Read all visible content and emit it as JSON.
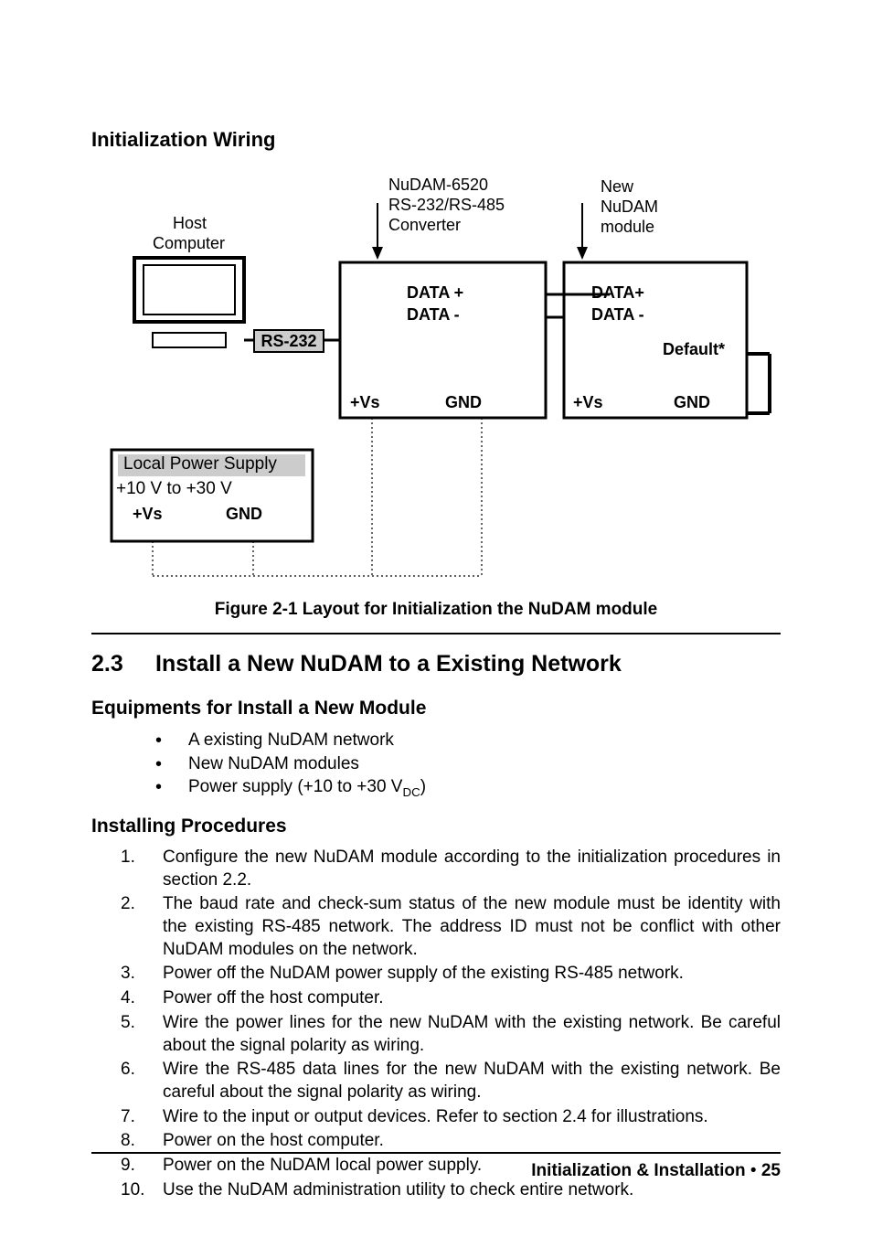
{
  "heading_init_wiring": "Initialization Wiring",
  "diagram": {
    "host_computer_l1": "Host",
    "host_computer_l2": "Computer",
    "converter_l1": "NuDAM-6520",
    "converter_l2": "RS-232/RS-485",
    "converter_l3": "Converter",
    "new_module_l1": "New",
    "new_module_l2": "NuDAM",
    "new_module_l3": "module",
    "rs232_label": "RS-232",
    "data_plus": "DATA +",
    "data_minus": "DATA -",
    "data_plus_b": "DATA+",
    "data_minus_b": "DATA -",
    "default_label": "Default*",
    "vs": "+Vs",
    "gnd": "GND",
    "power_title": "Local Power Supply",
    "power_range": "+10 V to +30 V",
    "caption": "Figure 2-1  Layout for Initialization the NuDAM module"
  },
  "section": {
    "num": "2.3",
    "title": "Install a New NuDAM to a Existing Network"
  },
  "equip_heading": "Equipments for Install a New Module",
  "equip_items": {
    "i1": "A existing NuDAM network",
    "i2": "New NuDAM modules",
    "i3_pre": "Power supply (+10 to +30 V",
    "i3_sub": "DC",
    "i3_post": ")"
  },
  "proc_heading": "Installing Procedures",
  "steps": {
    "s1": "Configure the new NuDAM module according to the initialization procedures in section 2.2.",
    "s2": "The baud rate and check-sum status of the new module must be identity with the existing RS-485 network.  The address ID must not be conflict with other NuDAM modules on the network.",
    "s3": "Power off the NuDAM power supply of the existing RS-485 network.",
    "s4": "Power off the host computer.",
    "s5": "Wire the power lines for the new NuDAM with the existing network.  Be careful about the signal polarity as wiring.",
    "s6": "Wire the RS-485 data lines for the new NuDAM with the existing network.  Be careful about the signal polarity as wiring.",
    "s7": "Wire to the input or output devices.  Refer to section 2.4 for illustrations.",
    "s8": "Power on the host computer.",
    "s9": "Power on the NuDAM local power supply.",
    "s10": "Use the NuDAM administration utility to check entire network."
  },
  "footer": {
    "chapter": "Initialization & Installation",
    "bullet": " • ",
    "page": "25"
  }
}
